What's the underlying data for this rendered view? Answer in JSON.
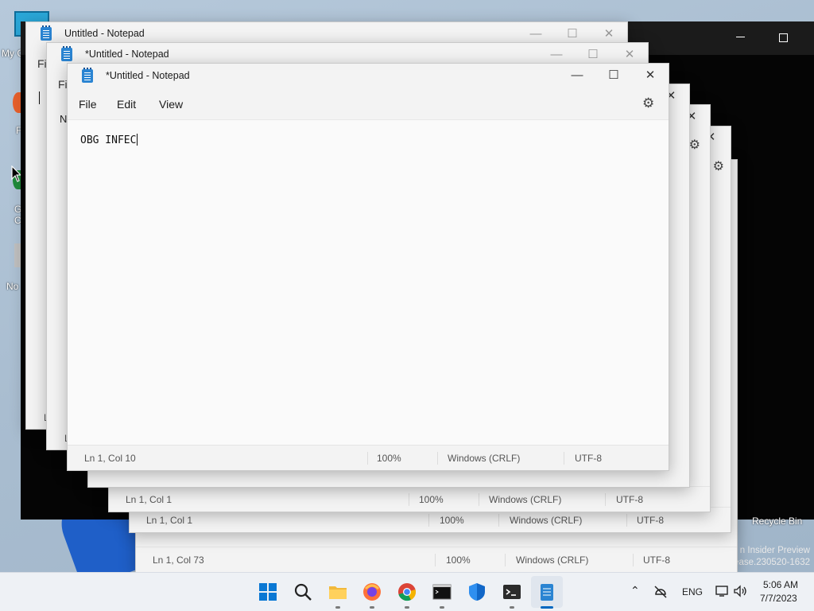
{
  "desktop": {
    "icons": [
      {
        "label": "My C",
        "icon": "this-pc-icon"
      },
      {
        "label": "F",
        "icon": "firefox-icon"
      },
      {
        "label": "G",
        "icon": "chrome-icon"
      },
      {
        "label": "C",
        "icon": "chrome-icon"
      },
      {
        "label": "No",
        "icon": "notepad-shortcut-icon"
      }
    ],
    "recycle_bin": "Recycle Bin",
    "watermark_line1": "n Insider Preview",
    "watermark_line2": "ease.230520-1632"
  },
  "windows": {
    "back1": {
      "title": "Untitled - Notepad",
      "menu_file": "Fil",
      "text": "",
      "status_ln": "L"
    },
    "back2": {
      "title": "*Untitled - Notepad",
      "menu_file": "Fi",
      "text": "No",
      "status_ln": "L"
    },
    "stack_a": {
      "status_ln": "Ln 1, Col 1",
      "zoom": "100%",
      "eol": "Windows (CRLF)",
      "encoding": "UTF-8"
    },
    "stack_b": {
      "status_ln": "Ln 1, Col 1",
      "zoom": "100%",
      "eol": "Windows (CRLF)",
      "encoding": "UTF-8"
    },
    "stack_c": {
      "status_ln": "Ln 1, Col 73",
      "zoom": "100%",
      "eol": "Windows (CRLF)",
      "encoding": "UTF-8"
    },
    "front": {
      "title": "*Untitled - Notepad",
      "menu": {
        "file": "File",
        "edit": "Edit",
        "view": "View"
      },
      "content": "OBG INFEC",
      "status": {
        "position": "Ln 1, Col 10",
        "zoom": "100%",
        "eol": "Windows (CRLF)",
        "encoding": "UTF-8"
      }
    }
  },
  "taskbar": {
    "apps": [
      {
        "name": "start",
        "icon": "windows-start-icon"
      },
      {
        "name": "search",
        "icon": "search-icon"
      },
      {
        "name": "file-explorer",
        "icon": "folder-icon"
      },
      {
        "name": "firefox",
        "icon": "firefox-icon"
      },
      {
        "name": "chrome",
        "icon": "chrome-icon"
      },
      {
        "name": "cmd",
        "icon": "command-prompt-icon"
      },
      {
        "name": "defender",
        "icon": "shield-icon"
      },
      {
        "name": "terminal",
        "icon": "terminal-icon"
      },
      {
        "name": "notepad",
        "icon": "notepad-icon"
      }
    ],
    "tray": {
      "language": "ENG",
      "time": "5:06 AM",
      "date": "7/7/2023"
    }
  },
  "colors": {
    "accent": "#0067c0",
    "notepad_blue": "#2a84d2"
  }
}
